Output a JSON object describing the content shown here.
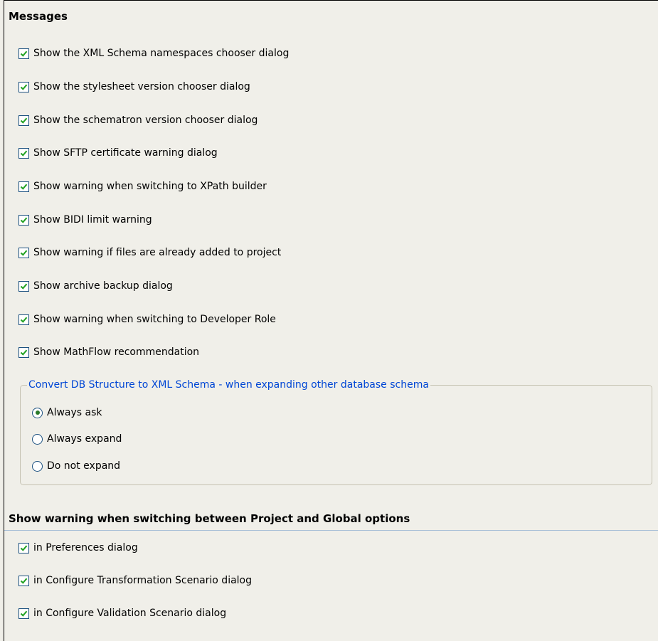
{
  "messages": {
    "title": "Messages",
    "items": [
      {
        "label": "Show the XML Schema namespaces chooser dialog",
        "checked": true
      },
      {
        "label": "Show the stylesheet version chooser dialog",
        "checked": true
      },
      {
        "label": "Show the schematron version chooser dialog",
        "checked": true
      },
      {
        "label": "Show SFTP certificate warning dialog",
        "checked": true
      },
      {
        "label": "Show warning when switching to XPath builder",
        "checked": true
      },
      {
        "label": "Show BIDI limit warning",
        "checked": true
      },
      {
        "label": "Show warning if files are already added to project",
        "checked": true
      },
      {
        "label": "Show archive backup dialog",
        "checked": true
      },
      {
        "label": "Show warning when switching to Developer Role",
        "checked": true
      },
      {
        "label": "Show MathFlow recommendation",
        "checked": true
      }
    ]
  },
  "convert_group": {
    "title": "Convert DB Structure to XML Schema - when expanding other database schema",
    "options": [
      {
        "label": "Always ask",
        "selected": true
      },
      {
        "label": "Always expand",
        "selected": false
      },
      {
        "label": "Do not expand",
        "selected": false
      }
    ]
  },
  "switching": {
    "title": "Show warning when switching between Project and Global options",
    "items": [
      {
        "label": "in Preferences dialog",
        "checked": true
      },
      {
        "label": "in Configure Transformation Scenario dialog",
        "checked": true
      },
      {
        "label": "in Configure Validation Scenario dialog",
        "checked": true
      }
    ]
  },
  "colors": {
    "background": "#f0efe9",
    "check_mark": "#21a121",
    "group_title": "#0046d5"
  }
}
